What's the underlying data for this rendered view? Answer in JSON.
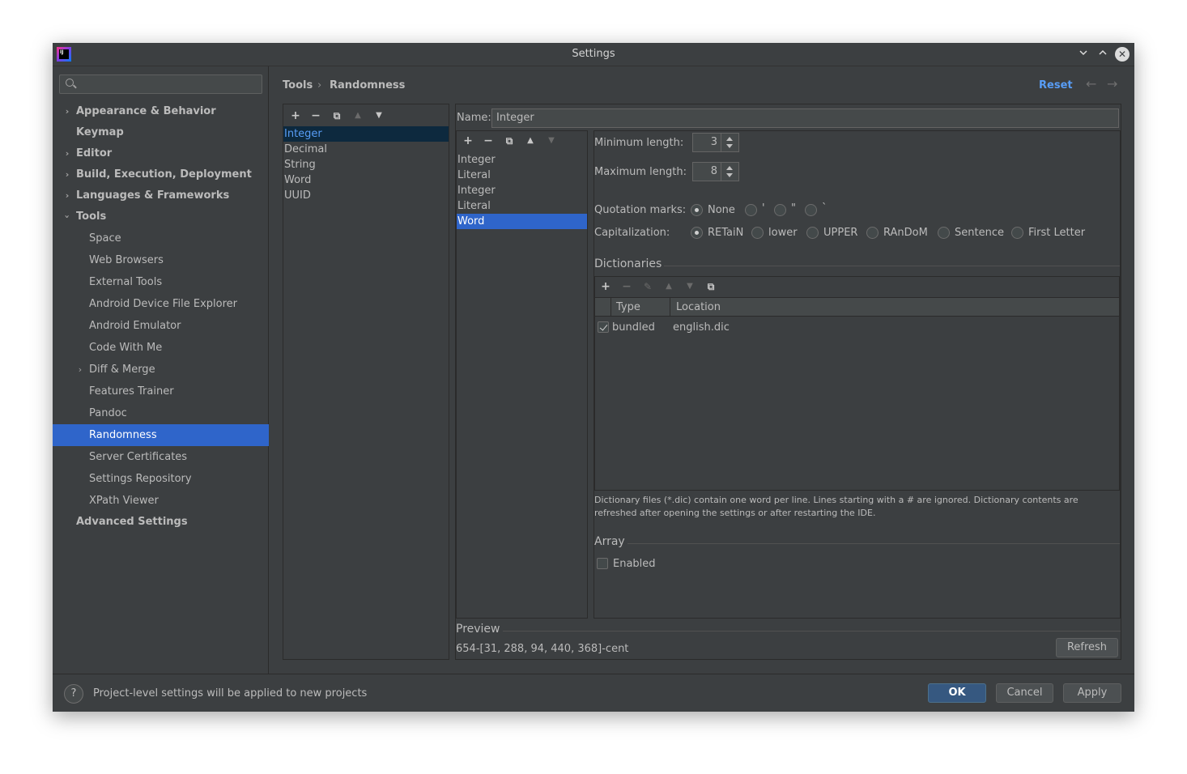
{
  "window": {
    "title": "Settings",
    "app_icon_text": "IJ"
  },
  "search": {
    "placeholder": ""
  },
  "sidebar": {
    "items": [
      {
        "label": "Appearance & Behavior"
      },
      {
        "label": "Keymap"
      },
      {
        "label": "Editor"
      },
      {
        "label": "Build, Execution, Deployment"
      },
      {
        "label": "Languages & Frameworks"
      },
      {
        "label": "Tools"
      },
      {
        "label": "Space"
      },
      {
        "label": "Web Browsers"
      },
      {
        "label": "External Tools"
      },
      {
        "label": "Android Device File Explorer"
      },
      {
        "label": "Android Emulator"
      },
      {
        "label": "Code With Me"
      },
      {
        "label": "Diff & Merge"
      },
      {
        "label": "Features Trainer"
      },
      {
        "label": "Pandoc"
      },
      {
        "label": "Randomness"
      },
      {
        "label": "Server Certificates"
      },
      {
        "label": "Settings Repository"
      },
      {
        "label": "XPath Viewer"
      },
      {
        "label": "Advanced Settings"
      }
    ]
  },
  "breadcrumb": {
    "parent": "Tools",
    "separator": "›",
    "current": "Randomness"
  },
  "header": {
    "reset_label": "Reset",
    "back_arrow": "←",
    "forward_arrow": "→"
  },
  "schemes": {
    "items": [
      "Integer",
      "Decimal",
      "String",
      "Word",
      "UUID"
    ],
    "selected": "Integer"
  },
  "name_field": {
    "label": "Name:",
    "value": "Integer"
  },
  "parts": {
    "items": [
      "Integer",
      "Literal",
      "Integer",
      "Literal",
      "Word"
    ],
    "selected": "Word"
  },
  "word": {
    "min_label": "Minimum length:",
    "min_value": "3",
    "max_label": "Maximum length:",
    "max_value": "8",
    "quotation_label": "Quotation marks:",
    "quotation_options": [
      "None",
      "'",
      "\"",
      "`"
    ],
    "quotation_selected": "None",
    "capitalization_label": "Capitalization:",
    "capitalization_options": [
      "RETaiN",
      "lower",
      "UPPER",
      "RAnDoM",
      "Sentence",
      "First Letter"
    ],
    "capitalization_selected": "RETaiN"
  },
  "dictionaries": {
    "title": "Dictionaries",
    "columns": [
      "Type",
      "Location"
    ],
    "rows": [
      {
        "checked": true,
        "type": "bundled",
        "location": "english.dic"
      }
    ],
    "help": "Dictionary files (*.dic) contain one word per line. Lines starting with a # are ignored. Dictionary contents are refreshed after opening the settings or after restarting the IDE."
  },
  "array": {
    "title": "Array",
    "enabled_label": "Enabled",
    "enabled": false
  },
  "preview": {
    "title": "Preview",
    "value": "654-[31, 288, 94, 440, 368]-cent",
    "refresh_label": "Refresh"
  },
  "footer": {
    "help_icon": "?",
    "message": "Project-level settings will be applied to new projects",
    "ok_label": "OK",
    "cancel_label": "Cancel",
    "apply_label": "Apply"
  }
}
